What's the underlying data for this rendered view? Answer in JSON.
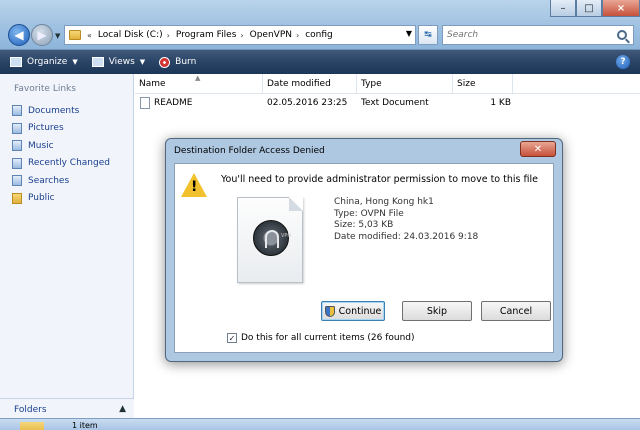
{
  "window": {
    "minimize": "–",
    "maximize": "□",
    "close": "×"
  },
  "address": {
    "prefix": "«",
    "crumbs": [
      "Local Disk (C:)",
      "Program Files",
      "OpenVPN",
      "config"
    ],
    "search_placeholder": "Search"
  },
  "toolbar": {
    "organize": "Organize",
    "views": "Views",
    "burn": "Burn",
    "help": "?"
  },
  "sidebar": {
    "title": "Favorite Links",
    "items": [
      "Documents",
      "Pictures",
      "Music",
      "Recently Changed",
      "Searches",
      "Public"
    ],
    "folders_label": "Folders"
  },
  "columns": {
    "name": "Name",
    "date_modified": "Date modified",
    "type": "Type",
    "size": "Size"
  },
  "files": [
    {
      "name": "README",
      "date_modified": "02.05.2016 23:25",
      "type": "Text Document",
      "size": "1 KB"
    }
  ],
  "status": {
    "text": "1 item"
  },
  "dialog": {
    "title": "Destination Folder Access Denied",
    "message": "You'll need to provide administrator permission to move to this file",
    "file_icon_label": "VPN",
    "file_info": {
      "name": "China, Hong Kong hk1",
      "type": "Type: OVPN File",
      "size": "Size: 5,03 KB",
      "date": "Date modified: 24.03.2016 9:18"
    },
    "buttons": {
      "continue": "Continue",
      "skip": "Skip",
      "cancel": "Cancel"
    },
    "checkbox_label": "Do this for all current items (26 found)",
    "checkbox_checked": true
  }
}
